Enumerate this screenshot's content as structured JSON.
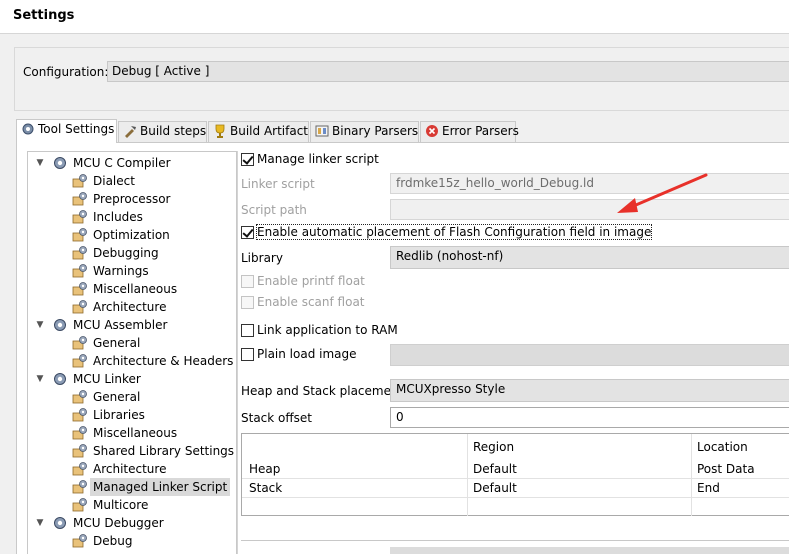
{
  "window": {
    "title": "Settings"
  },
  "configuration": {
    "label": "Configuration:",
    "value": "Debug  [ Active ]"
  },
  "tabs": [
    {
      "label": "Tool Settings",
      "icon": "tool-settings-icon",
      "active": true
    },
    {
      "label": "Build steps",
      "icon": "build-steps-icon",
      "active": false
    },
    {
      "label": "Build Artifact",
      "icon": "trophy-icon",
      "active": false
    },
    {
      "label": "Binary Parsers",
      "icon": "binary-parsers-icon",
      "active": false
    },
    {
      "label": "Error Parsers",
      "icon": "error-icon",
      "active": false
    }
  ],
  "tree": {
    "items": [
      {
        "label": "MCU C Compiler",
        "type": "category"
      },
      {
        "label": "Dialect",
        "type": "option"
      },
      {
        "label": "Preprocessor",
        "type": "option"
      },
      {
        "label": "Includes",
        "type": "option"
      },
      {
        "label": "Optimization",
        "type": "option"
      },
      {
        "label": "Debugging",
        "type": "option"
      },
      {
        "label": "Warnings",
        "type": "option"
      },
      {
        "label": "Miscellaneous",
        "type": "option"
      },
      {
        "label": "Architecture",
        "type": "option"
      },
      {
        "label": "MCU Assembler",
        "type": "category"
      },
      {
        "label": "General",
        "type": "option"
      },
      {
        "label": "Architecture & Headers",
        "type": "option"
      },
      {
        "label": "MCU Linker",
        "type": "category"
      },
      {
        "label": "General",
        "type": "option"
      },
      {
        "label": "Libraries",
        "type": "option"
      },
      {
        "label": "Miscellaneous",
        "type": "option"
      },
      {
        "label": "Shared Library Settings",
        "type": "option"
      },
      {
        "label": "Architecture",
        "type": "option"
      },
      {
        "label": "Managed Linker Script",
        "type": "option",
        "selected": true
      },
      {
        "label": "Multicore",
        "type": "option"
      },
      {
        "label": "MCU Debugger",
        "type": "category"
      },
      {
        "label": "Debug",
        "type": "option"
      }
    ]
  },
  "panel": {
    "manage_linker_script": {
      "label": "Manage linker script",
      "checked": true
    },
    "linker_script": {
      "label": "Linker script",
      "value": "frdmke15z_hello_world_Debug.ld"
    },
    "script_path": {
      "label": "Script path",
      "value": ""
    },
    "flash_config": {
      "label": "Enable automatic placement of Flash Configuration field in image",
      "checked": true
    },
    "library": {
      "label": "Library",
      "value": "Redlib (nohost-nf)"
    },
    "printf_float": {
      "label": "Enable printf float",
      "checked": false
    },
    "scanf_float": {
      "label": "Enable scanf float",
      "checked": false
    },
    "link_to_ram": {
      "label": "Link application to RAM",
      "checked": false
    },
    "plain_load_image": {
      "label": "Plain load image",
      "checked": false
    },
    "heap_stack_placement": {
      "label": "Heap and Stack placement",
      "value": "MCUXpresso Style"
    },
    "stack_offset": {
      "label": "Stack offset",
      "value": "0"
    },
    "heap_stack_table": {
      "headers": [
        "",
        "Region",
        "Location"
      ],
      "rows": [
        [
          "Heap",
          "Default",
          "Post Data"
        ],
        [
          "Stack",
          "Default",
          "End"
        ]
      ]
    }
  },
  "colors": {
    "annotation_arrow": "#e8312a"
  }
}
